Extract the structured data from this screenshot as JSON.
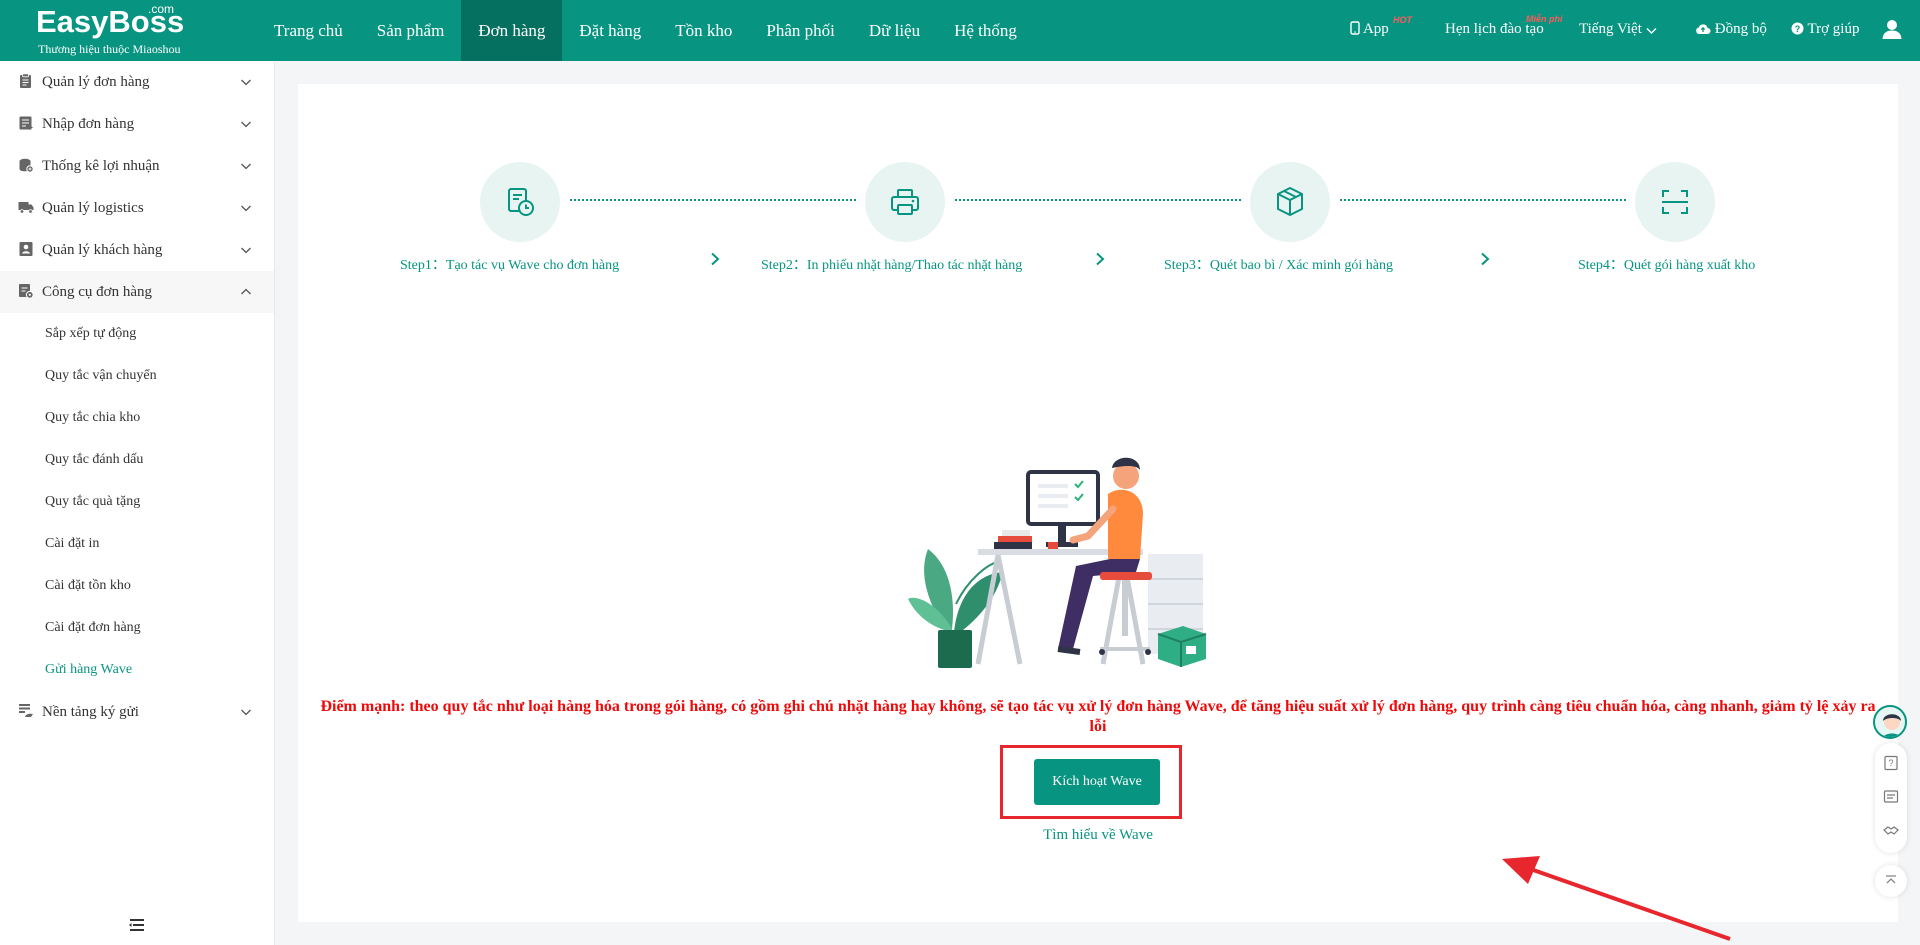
{
  "brand": {
    "name": "EasyBoss",
    "domain_suffix": ".com",
    "tagline": "Thương hiệu thuộc Miaoshou"
  },
  "main_nav": [
    {
      "label": "Trang chủ",
      "active": false
    },
    {
      "label": "Sản phẩm",
      "active": false
    },
    {
      "label": "Đơn hàng",
      "active": true
    },
    {
      "label": "Đặt hàng",
      "active": false
    },
    {
      "label": "Tồn kho",
      "active": false
    },
    {
      "label": "Phân phối",
      "active": false
    },
    {
      "label": "Dữ liệu",
      "active": false
    },
    {
      "label": "Hệ thống",
      "active": false
    }
  ],
  "right_nav": {
    "app": "App",
    "app_badge": "HOT",
    "training": "Hẹn lịch đào tạo",
    "training_badge": "Miễn phí",
    "language": "Tiếng Việt",
    "sync": "Đồng bộ",
    "help": "Trợ giúp"
  },
  "sidebar": {
    "groups_before": [
      {
        "label": "Quản lý đơn hàng",
        "icon": "order-list-icon"
      },
      {
        "label": "Nhập đơn hàng",
        "icon": "import-icon"
      },
      {
        "label": "Thống kê lợi nhuận",
        "icon": "profit-icon"
      },
      {
        "label": "Quản lý logistics",
        "icon": "truck-icon"
      },
      {
        "label": "Quản lý khách hàng",
        "icon": "customer-icon"
      }
    ],
    "open_group": {
      "label": "Công cụ đơn hàng",
      "icon": "tool-icon"
    },
    "sub_items": [
      {
        "label": "Sắp xếp tự động",
        "active": false
      },
      {
        "label": "Quy tắc vận chuyển",
        "active": false
      },
      {
        "label": "Quy tắc chia kho",
        "active": false
      },
      {
        "label": "Quy tắc đánh dấu",
        "active": false
      },
      {
        "label": "Quy tắc quà tặng",
        "active": false
      },
      {
        "label": "Cài đặt in",
        "active": false
      },
      {
        "label": "Cài đặt tồn kho",
        "active": false
      },
      {
        "label": "Cài đặt đơn hàng",
        "active": false
      },
      {
        "label": "Gửi hàng Wave",
        "active": true
      }
    ],
    "groups_after": [
      {
        "label": "Nền tảng ký gửi",
        "icon": "consign-icon"
      }
    ]
  },
  "steps": [
    {
      "label": "Step1：Tạo tác vụ Wave cho đơn hàng",
      "icon": "wave-task-icon"
    },
    {
      "label": "Step2：In phiếu nhặt hàng/Thao tác nhặt hàng",
      "icon": "printer-icon"
    },
    {
      "label": "Step3：Quét bao bì / Xác minh gói hàng",
      "icon": "package-icon"
    },
    {
      "label": "Step4：Quét gói hàng xuất kho",
      "icon": "scan-icon"
    }
  ],
  "description": "Điểm mạnh: theo quy tắc như loại hàng hóa trong gói hàng, có gồm ghi chú nhặt hàng hay không, sẽ tạo tác vụ xử lý đơn hàng Wave, để tăng hiệu suất xử lý đơn hàng, quy trình càng tiêu chuẩn hóa, càng nhanh, giảm tỷ lệ xảy ra lỗi",
  "activate_button": "Kích hoạt Wave",
  "learn_link": "Tìm hiểu về Wave",
  "colors": {
    "brand": "#079581",
    "brand_dark": "#05705f",
    "highlight": "#e8262d",
    "warning_text": "#ee0a0a"
  }
}
